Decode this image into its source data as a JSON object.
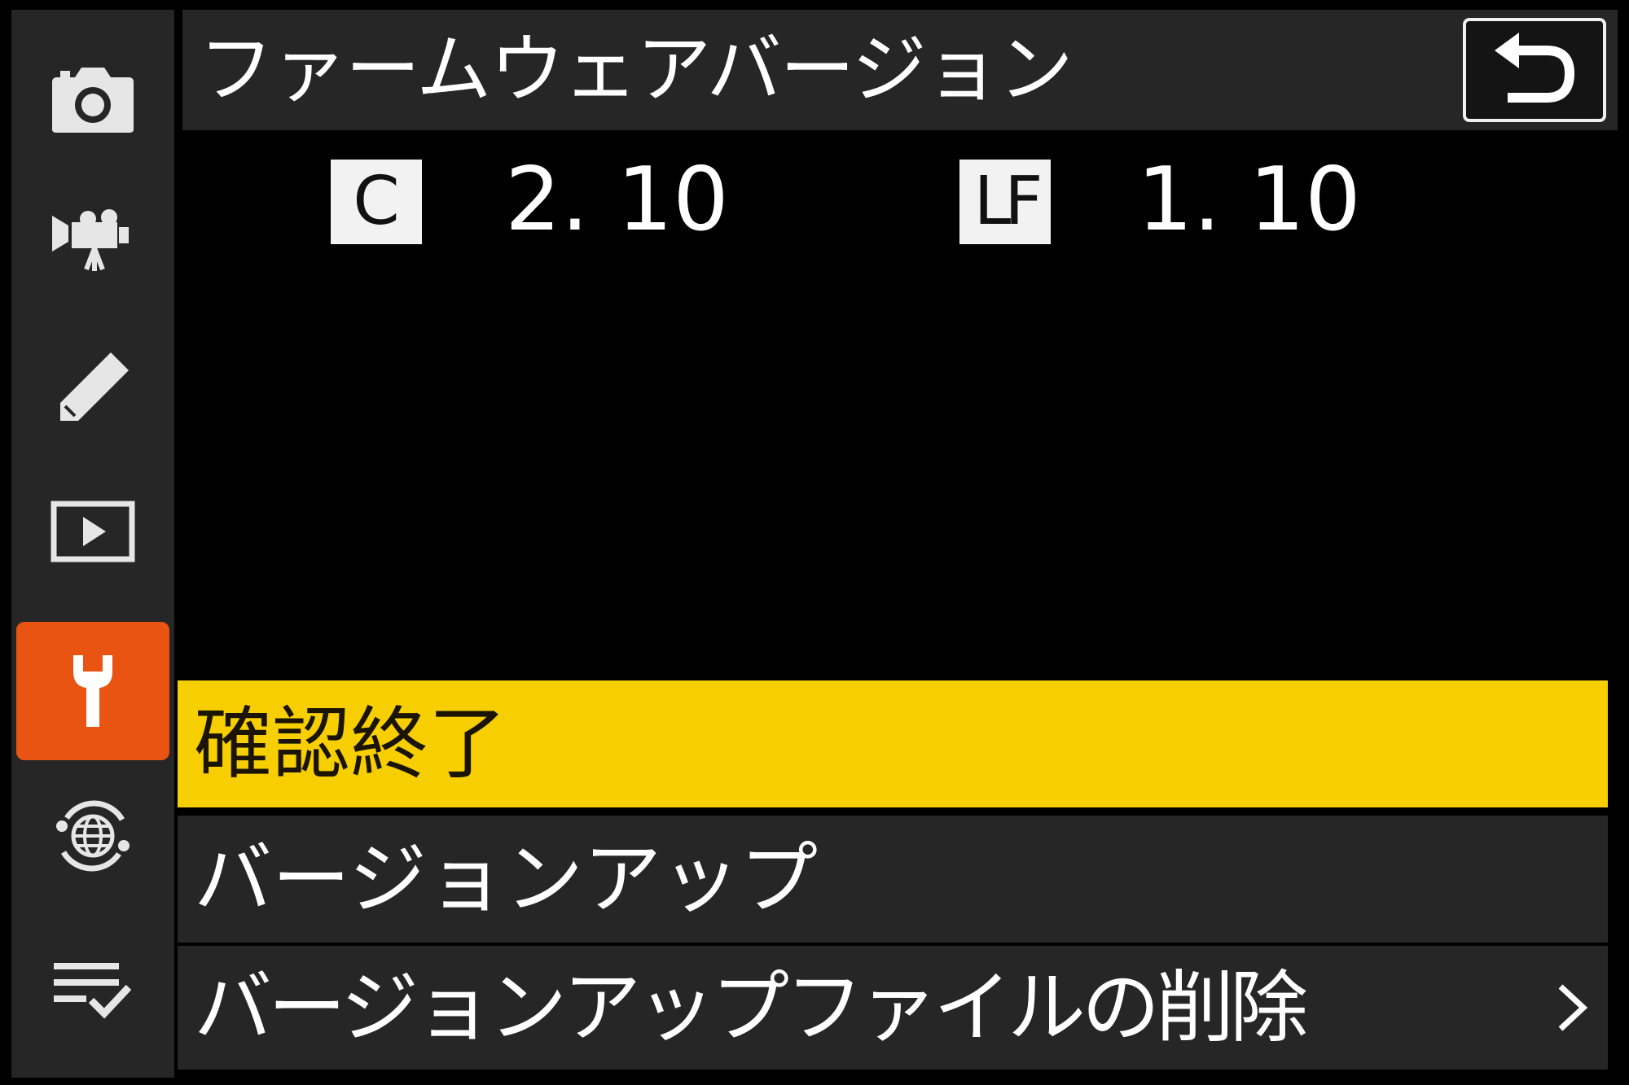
{
  "header": {
    "title": "ファームウェアバージョン"
  },
  "versions": [
    {
      "badge": "C",
      "value": "2. 10"
    },
    {
      "badge": "LF",
      "value": "1. 10"
    }
  ],
  "menu": {
    "items": [
      {
        "label": "確認終了",
        "selected": true
      },
      {
        "label": "バージョンアップ",
        "selected": false
      },
      {
        "label": "バージョンアップファイルの削除",
        "selected": false,
        "has_submenu": true
      }
    ]
  },
  "sidebar": {
    "items": [
      {
        "icon": "camera-icon"
      },
      {
        "icon": "video-camera-icon"
      },
      {
        "icon": "pencil-icon"
      },
      {
        "icon": "playback-icon"
      },
      {
        "icon": "wrench-icon",
        "active": true
      },
      {
        "icon": "network-globe-icon"
      },
      {
        "icon": "my-menu-icon"
      }
    ]
  },
  "colors": {
    "highlight": "#f7cf00",
    "active_tab": "#ea5412",
    "panel": "#262626",
    "background": "#000000"
  }
}
